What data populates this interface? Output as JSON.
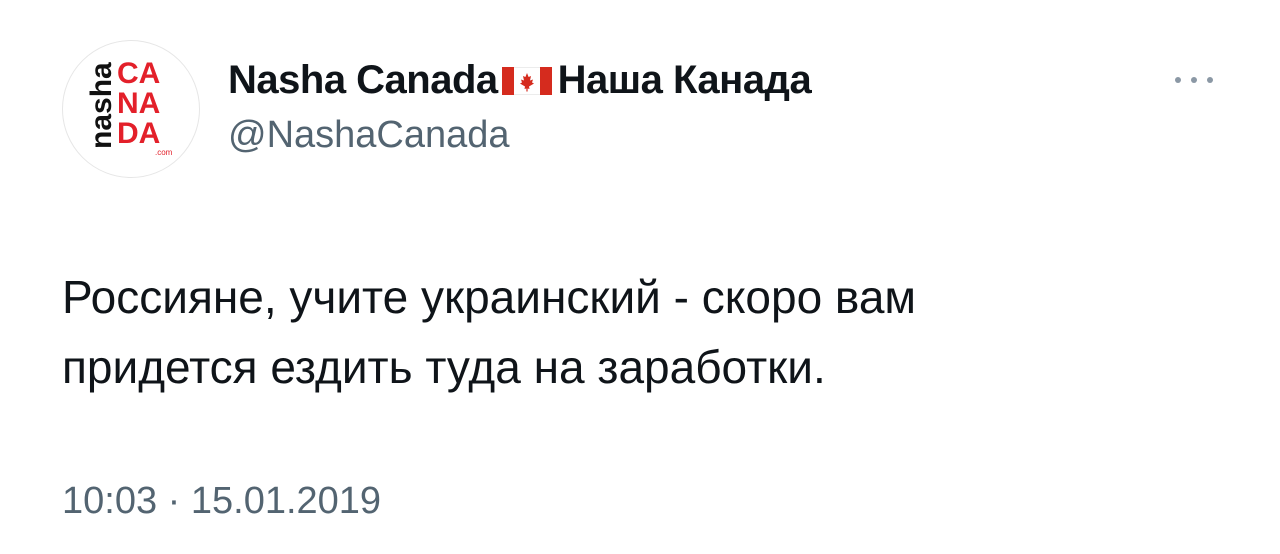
{
  "author": {
    "display_name_latin": "Nasha Canada",
    "display_name_cyrillic": "Наша Канада",
    "flag_icon": "canada-flag-icon",
    "handle": "@NashaCanada",
    "avatar": {
      "logo_text_vertical": "nasha",
      "logo_lines": [
        "CA",
        "NA",
        "DA"
      ],
      "logo_suffix": ".com",
      "logo_color": "#e3202a"
    }
  },
  "menu": {
    "more_icon": "more-dots-icon"
  },
  "tweet": {
    "lines": [
      "Россияне, учите украинский - скоро вам",
      "придется ездить туда на заработки."
    ],
    "timestamp": "10:03 · 15.01.2019"
  },
  "colors": {
    "text_primary": "#0f1419",
    "text_secondary": "#536471",
    "flag_red": "#d52b1e"
  }
}
